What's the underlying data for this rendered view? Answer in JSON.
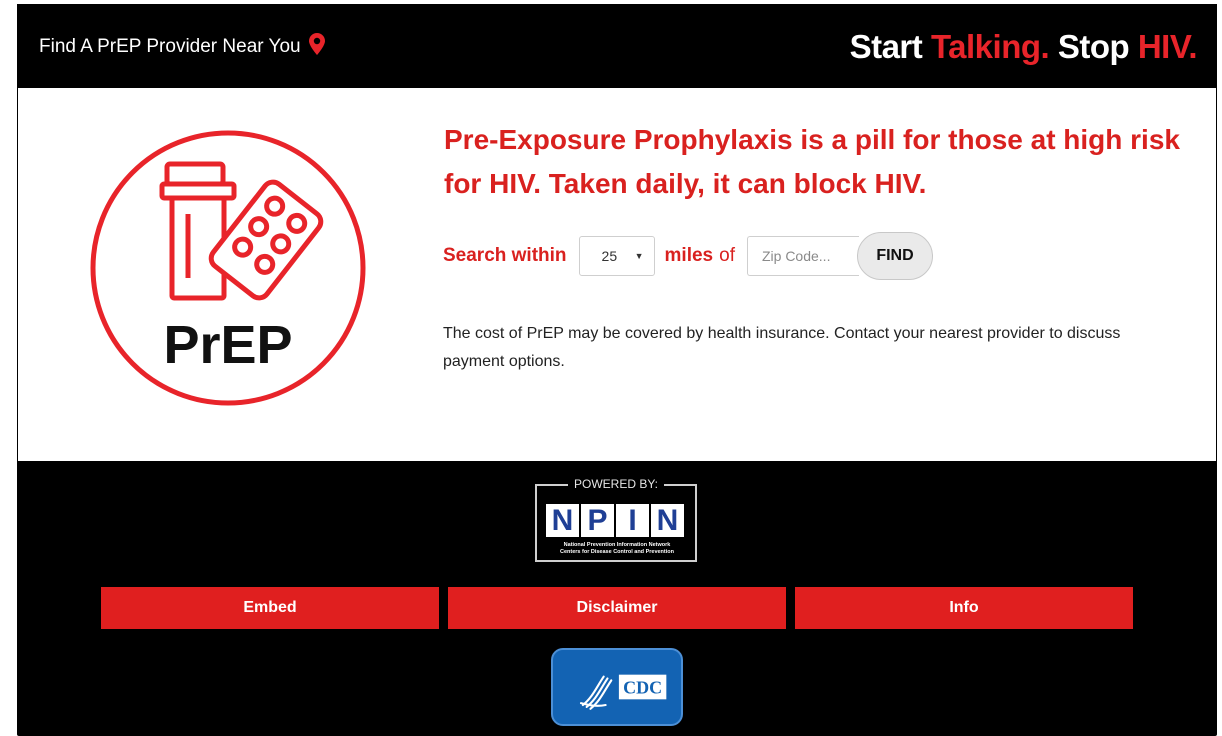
{
  "header": {
    "title": "Find A PrEP Provider Near You",
    "slogan_part1": "Start ",
    "slogan_part2": "Talking.",
    "slogan_part3": " Stop ",
    "slogan_part4": "HIV.",
    "pin_icon": "map-pin-icon"
  },
  "logo": {
    "text": "PrEP"
  },
  "main": {
    "headline": "Pre-Exposure Prophylaxis is a pill for those at high risk for HIV. Taken daily, it can block HIV.",
    "search_label": "Search within",
    "miles_value": "25",
    "miles_label": "miles",
    "of_label": "of",
    "zip_placeholder": "Zip Code...",
    "find_label": "FIND",
    "cost_text": "The cost of PrEP may be covered by health insurance. Contact your nearest provider to discuss payment options."
  },
  "powered": {
    "label": "POWERED BY:",
    "letters": [
      "N",
      "P",
      "I",
      "N"
    ],
    "sub_line1": "National Prevention Information Network",
    "sub_line2": "Centers for Disease Control and Prevention"
  },
  "footer": {
    "buttons": [
      "Embed",
      "Disclaimer",
      "Info"
    ]
  },
  "cdc": {
    "text": "CDC"
  },
  "colors": {
    "brand_red": "#e8242a",
    "cdc_blue": "#1363b3"
  }
}
